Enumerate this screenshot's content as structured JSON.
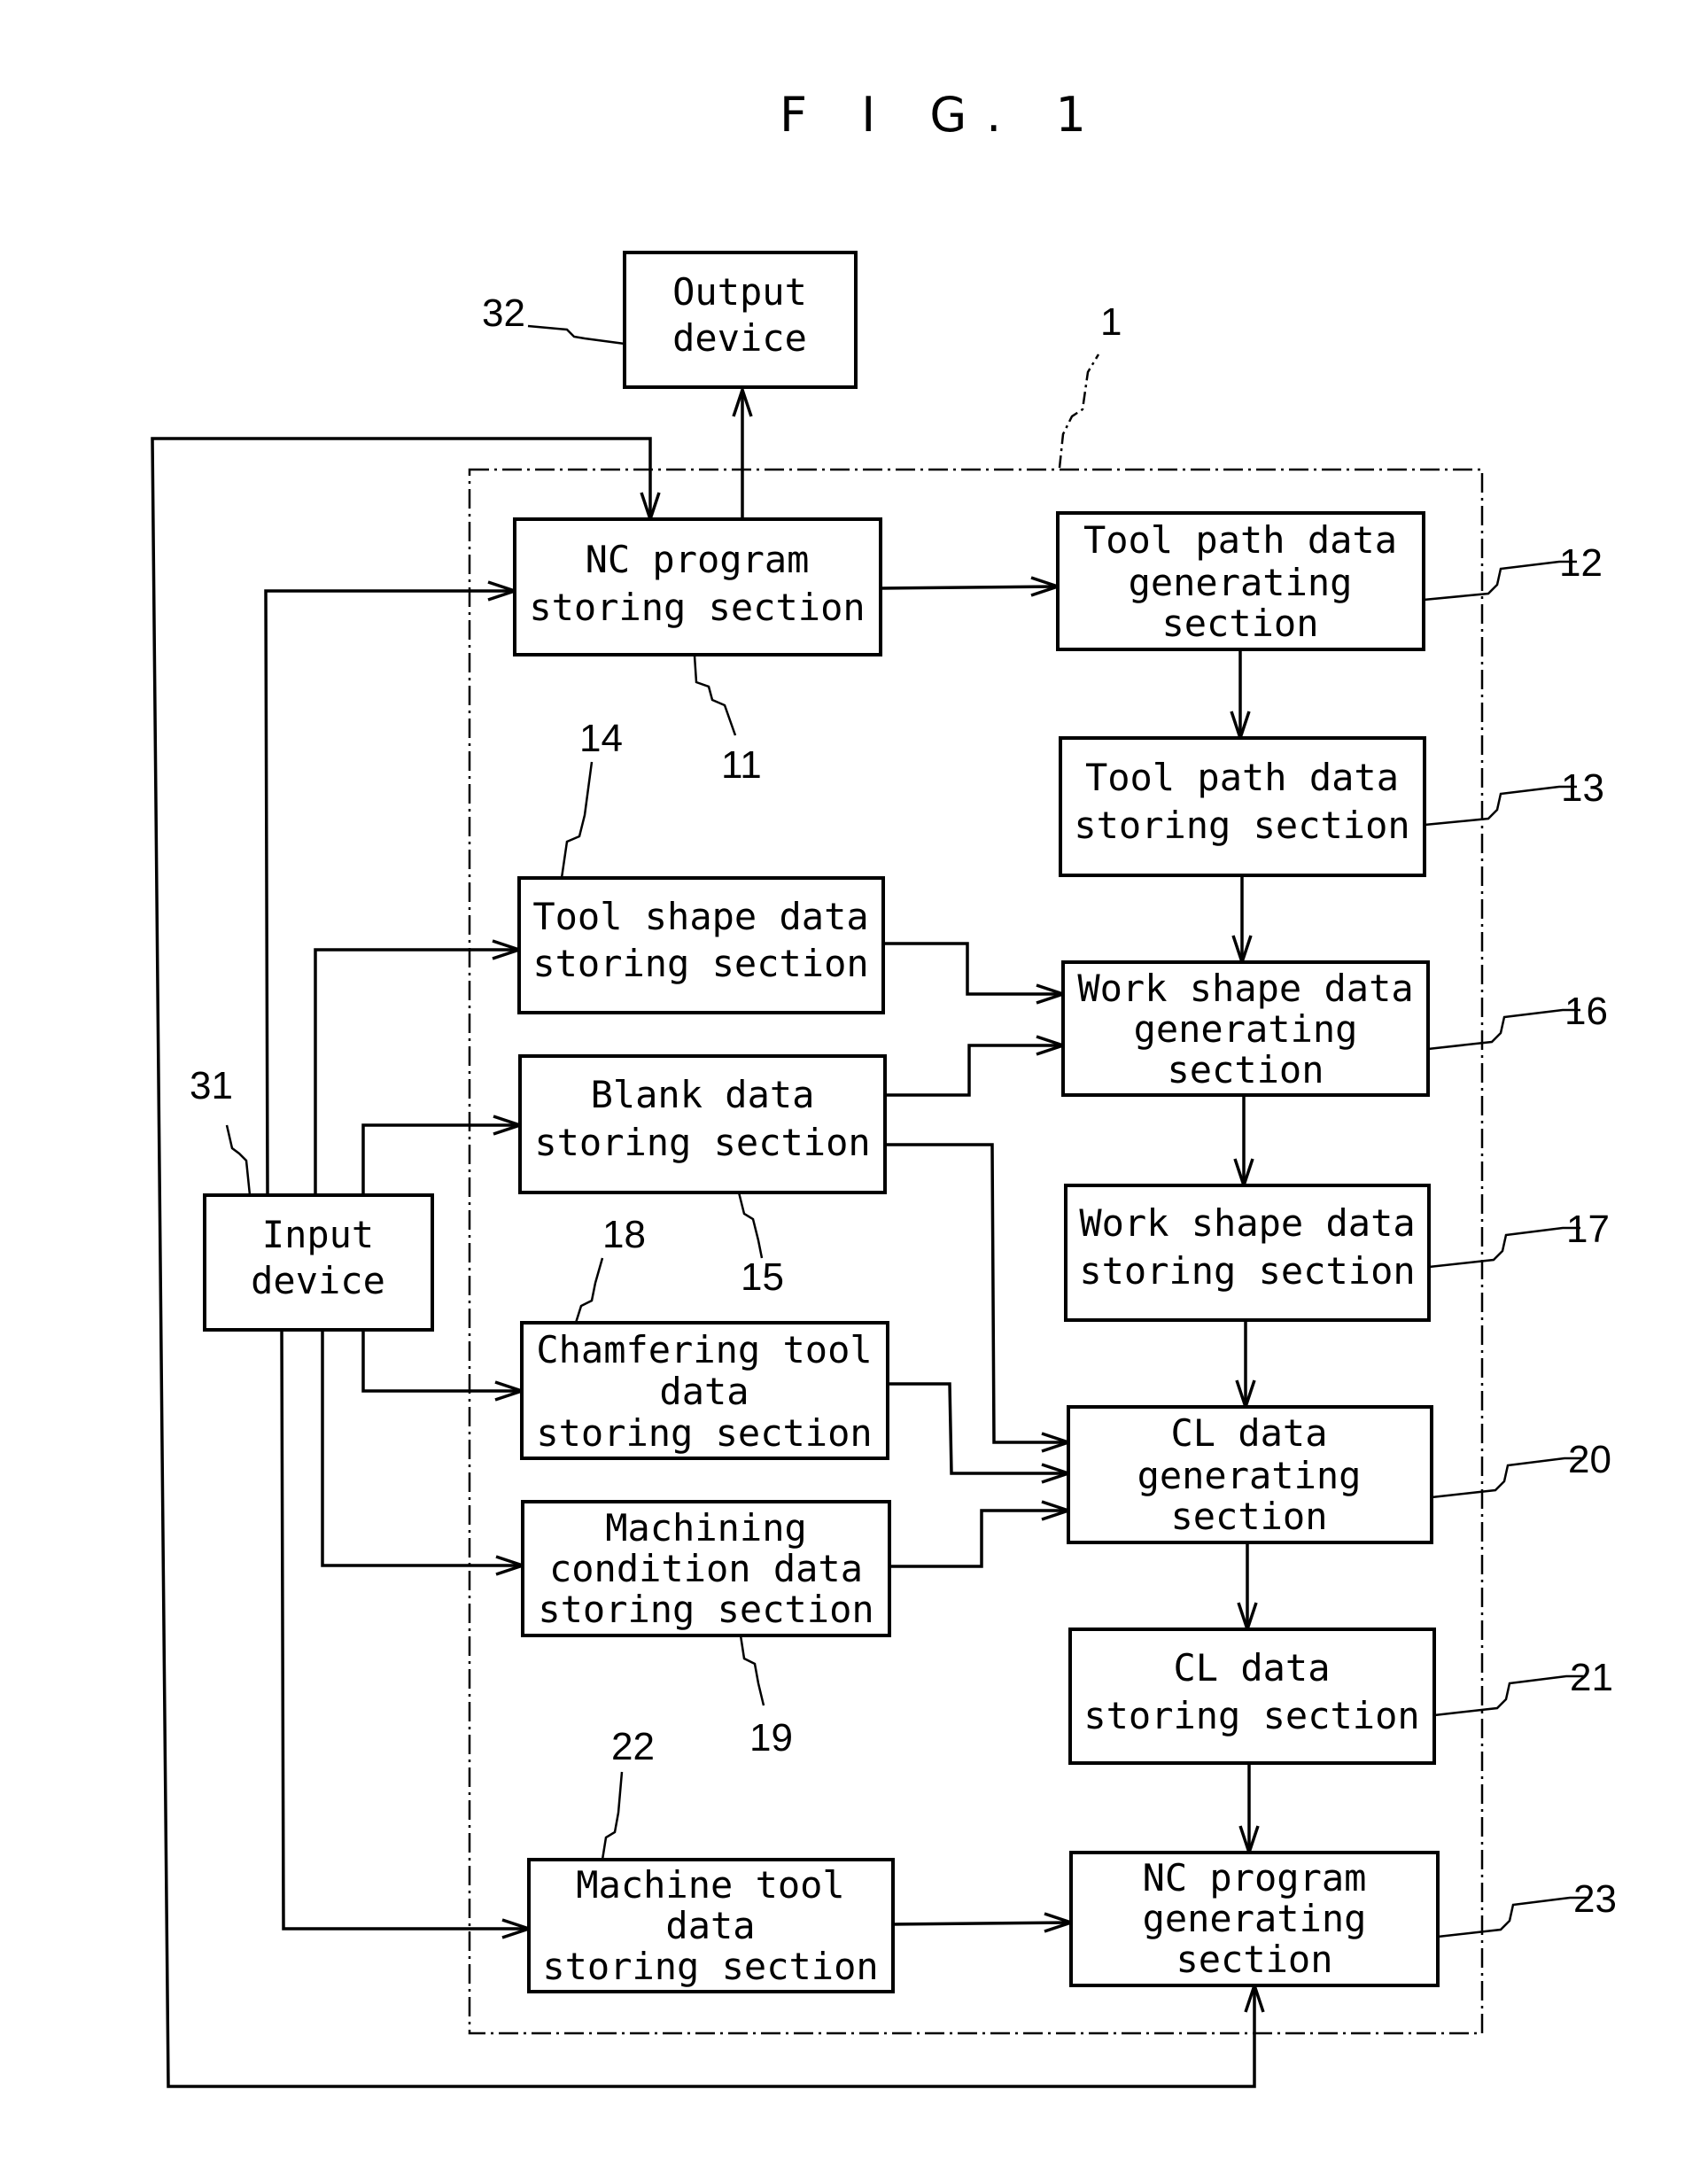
{
  "figure": {
    "title": "F I G. 1",
    "boundary_ref": "1"
  },
  "boxes": {
    "output_device": {
      "lines": [
        "Output",
        "device"
      ],
      "ref": "32"
    },
    "input_device": {
      "lines": [
        "Input",
        "device"
      ],
      "ref": "31"
    },
    "nc_program_storing": {
      "lines": [
        "NC program",
        "storing section"
      ],
      "ref": "11"
    },
    "tool_path_generating": {
      "lines": [
        "Tool path data",
        "generating",
        "section"
      ],
      "ref": "12"
    },
    "tool_path_storing": {
      "lines": [
        "Tool path data",
        "storing section"
      ],
      "ref": "13"
    },
    "tool_shape_storing": {
      "lines": [
        "Tool shape data",
        "storing section"
      ],
      "ref": "14"
    },
    "blank_storing": {
      "lines": [
        "Blank data",
        "storing section"
      ],
      "ref": "15"
    },
    "work_shape_generating": {
      "lines": [
        "Work shape data",
        "generating",
        "section"
      ],
      "ref": "16"
    },
    "work_shape_storing": {
      "lines": [
        "Work shape data",
        "storing section"
      ],
      "ref": "17"
    },
    "chamfering_tool_storing": {
      "lines": [
        "Chamfering tool",
        "data",
        "storing section"
      ],
      "ref": "18"
    },
    "machining_condition_storing": {
      "lines": [
        "Machining",
        "condition data",
        "storing section"
      ],
      "ref": "19"
    },
    "cl_generating": {
      "lines": [
        "CL data",
        "generating",
        "section"
      ],
      "ref": "20"
    },
    "cl_storing": {
      "lines": [
        "CL data",
        "storing section"
      ],
      "ref": "21"
    },
    "machine_tool_storing": {
      "lines": [
        "Machine tool",
        "data",
        "storing section"
      ],
      "ref": "22"
    },
    "nc_program_generating": {
      "lines": [
        "NC program",
        "generating",
        "section"
      ],
      "ref": "23"
    }
  }
}
